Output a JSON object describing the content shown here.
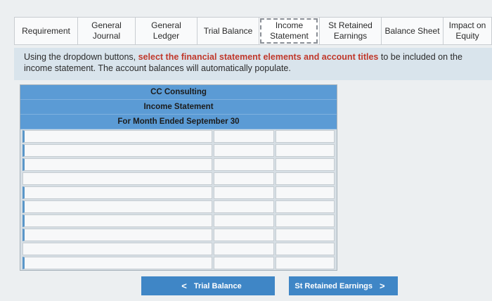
{
  "tabs": [
    {
      "label": "Requirement"
    },
    {
      "label": "General\nJournal"
    },
    {
      "label": "General\nLedger"
    },
    {
      "label": "Trial Balance"
    },
    {
      "label": "Income\nStatement"
    },
    {
      "label": "St Retained\nEarnings"
    },
    {
      "label": "Balance Sheet"
    },
    {
      "label": "Impact on\nEquity"
    }
  ],
  "instructions": {
    "prefix": "Using the dropdown buttons, ",
    "highlight": "select the financial statement elements and account titles",
    "suffix": " to be included on the income statement. The account balances will automatically populate."
  },
  "statement": {
    "company": "CC Consulting",
    "title": "Income Statement",
    "period": "For Month Ended September 30"
  },
  "nav": {
    "prev_label": "Trial Balance",
    "next_label": "St Retained Earnings",
    "prev_chevron": "<",
    "next_chevron": ">"
  }
}
